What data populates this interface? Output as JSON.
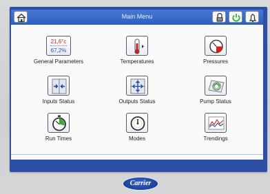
{
  "header": {
    "title": "Main Menu"
  },
  "tiles": [
    {
      "label": "General Parameters",
      "temp": "21,6°c",
      "percent": "67,2%"
    },
    {
      "label": "Temperatures"
    },
    {
      "label": "Pressures"
    },
    {
      "label": "Inputs Status"
    },
    {
      "label": "Outputs Status"
    },
    {
      "label": "Pump Status"
    },
    {
      "label": "Run Times"
    },
    {
      "label": "Modes"
    },
    {
      "label": "Trendings"
    }
  ],
  "brand": "Carrier",
  "colors": {
    "header": "#2e5fbf",
    "bezel": "#2d4fa6",
    "temp_text": "#d02020",
    "percent_text": "#2a4da8"
  }
}
